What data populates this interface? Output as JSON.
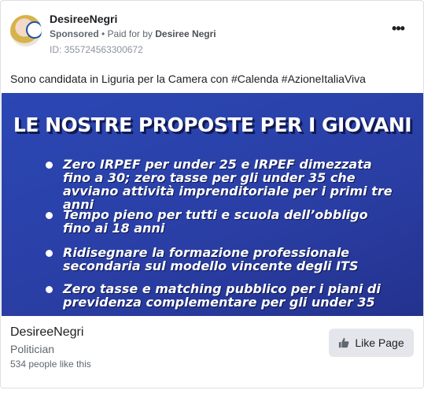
{
  "post": {
    "page_name": "DesireeNegri",
    "sponsored": "Sponsored",
    "separator": " • ",
    "paid_for_prefix": "Paid for by ",
    "payer": "Desiree Negri",
    "ad_id": "ID: 355724563300672",
    "more_icon": "more-dots-icon",
    "more_glyph": "•••",
    "caption": "Sono candidata in Liguria per la Camera con #Calenda #AzioneItaliaViva"
  },
  "creative": {
    "title": "LE NOSTRE PROPOSTE PER I GIOVANI",
    "bullets": [
      "Zero IRPEF per under 25 e IRPEF dimezzata fino a 30; zero tasse per gli under 35 che avviano attività imprenditoriale per i primi tre anni",
      "Tempo pieno per tutti e scuola dell’obbligo fino ai 18 anni",
      "Ridisegnare la formazione professionale secondaria sul modello vincente degli ITS",
      "Zero tasse e matching pubblico per i piani di previdenza complementare per gli under 35"
    ],
    "background": "#2a3fa6"
  },
  "footer": {
    "page_name": "DesireeNegri",
    "category": "Politician",
    "likes": "534 people like this",
    "like_button": "Like Page",
    "like_icon": "thumbs-up-icon"
  },
  "colors": {
    "button_bg": "#e4e6eb",
    "secondary_text": "#606770",
    "creative_blue": "#2a3fa6"
  }
}
